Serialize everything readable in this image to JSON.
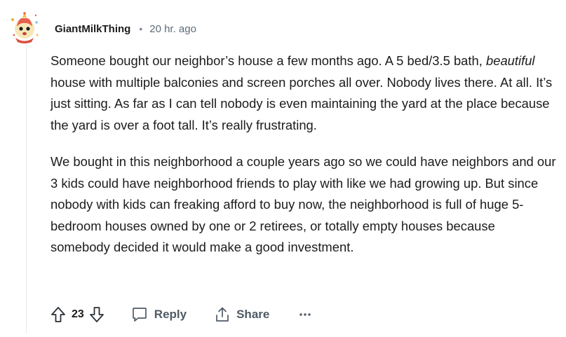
{
  "comment": {
    "username": "GiantMilkThing",
    "separator": "•",
    "timestamp": "20 hr. ago",
    "paragraph1_pre": "Someone bought our neighbor’s house a few months ago. A 5 bed/3.5 bath, ",
    "paragraph1_em": "beautiful",
    "paragraph1_post": " house with multiple balconies and screen porches all over. Nobody lives there. At all. It’s just sitting. As far as I can tell nobody is even maintaining the yard at the place because the yard is over a foot tall. It’s really frustrating.",
    "paragraph2": "We bought in this neighborhood a couple years ago so we could have neighbors and our 3 kids could have neighborhood friends to play with like we had growing up. But since nobody with kids can freaking afford to buy now, the neighborhood is full of huge 5-bedroom houses owned by one or 2 retirees, or totally empty houses because somebody decided it would make a good investment."
  },
  "actions": {
    "vote_count": "23",
    "reply_label": "Reply",
    "share_label": "Share",
    "icons": [
      "upvote-icon",
      "downvote-icon",
      "reply-icon",
      "share-icon",
      "more-icon"
    ]
  },
  "colors": {
    "text": "#1c1c1c",
    "meta": "#5c6c7a",
    "action": "#4f5a66",
    "thread_line": "#e5ebee"
  }
}
